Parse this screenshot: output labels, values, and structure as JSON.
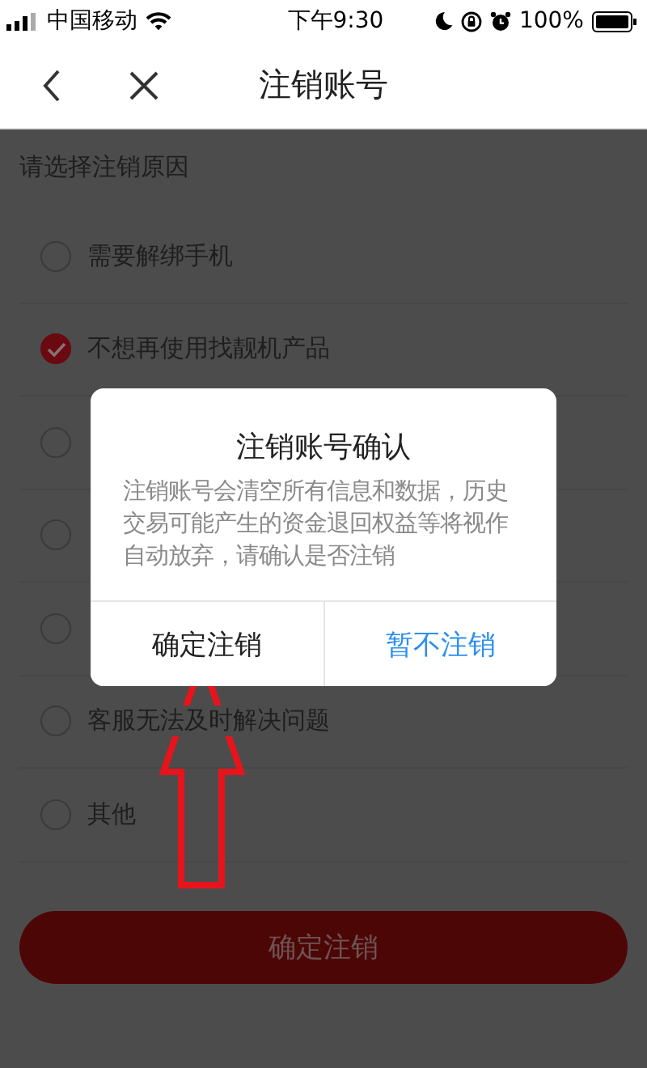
{
  "status_bar": {
    "carrier": "中国移动",
    "time": "下午9:30",
    "battery": "100%"
  },
  "nav": {
    "title": "注销账号"
  },
  "prompt": "请选择注销原因",
  "reasons": [
    {
      "label": "需要解绑手机",
      "checked": false
    },
    {
      "label": "不想再使用找靓机产品",
      "checked": true
    },
    {
      "checked": false
    },
    {
      "checked": false
    },
    {
      "checked": false
    },
    {
      "label": "客服无法及时解决问题",
      "checked": false
    },
    {
      "label": "其他",
      "checked": false
    }
  ],
  "submit_button": "确定注销",
  "dialog": {
    "title": "注销账号确认",
    "message": "注销账号会清空所有信息和数据，历史交易可能产生的资金退回权益等将视作自动放弃，请确认是否注销",
    "buttons": [
      {
        "label": "确定注销",
        "kind": "plain"
      },
      {
        "label": "暂不注销",
        "kind": "primary"
      }
    ]
  }
}
